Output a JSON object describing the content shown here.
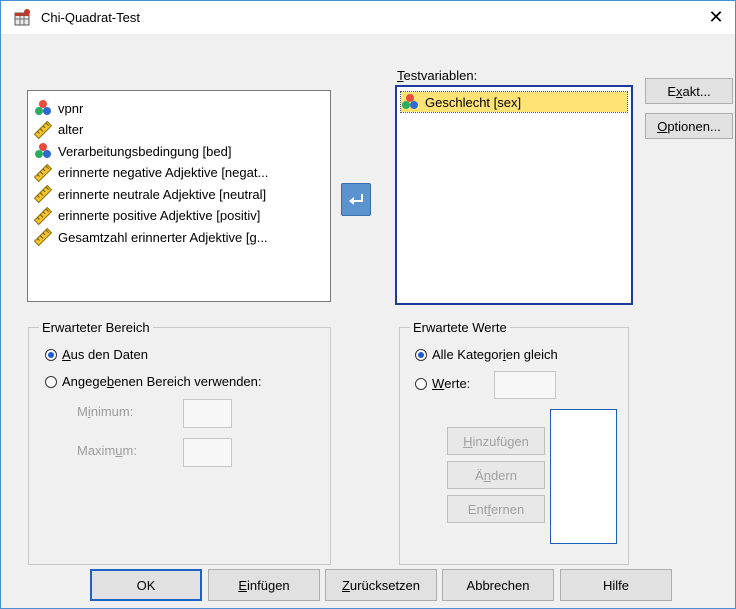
{
  "window": {
    "title": "Chi-Quadrat-Test",
    "close_glyph": "✕"
  },
  "source_list": {
    "items": [
      {
        "label": "vpnr",
        "icon": "nominal-icon"
      },
      {
        "label": "alter",
        "icon": "scale-icon"
      },
      {
        "label": "Verarbeitungsbedingung [bed]",
        "icon": "nominal-icon"
      },
      {
        "label": "erinnerte negative Adjektive [negat...",
        "icon": "scale-icon"
      },
      {
        "label": "erinnerte neutrale Adjektive [neutral]",
        "icon": "scale-icon"
      },
      {
        "label": "erinnerte positive Adjektive [positiv]",
        "icon": "scale-icon"
      },
      {
        "label": "Gesamtzahl erinnerter Adjektive [g...",
        "icon": "scale-icon"
      }
    ]
  },
  "test_vars": {
    "label_prefix": "T",
    "label_rest": "estvariablen:",
    "items": [
      {
        "label": "Geschlecht [sex]",
        "icon": "nominal-icon",
        "selected": true
      }
    ]
  },
  "side_buttons": {
    "exakt_a": "E",
    "exakt_u": "x",
    "exakt_b": "akt...",
    "optionen_u": "O",
    "optionen_b": "ptionen..."
  },
  "range": {
    "legend": "Erwarteter Bereich",
    "opt1_u": "A",
    "opt1_b": "us den Daten",
    "opt2_a": "Angege",
    "opt2_u": "b",
    "opt2_b": "enen Bereich verwenden:",
    "min_a": "M",
    "min_u": "i",
    "min_b": "nimum:",
    "max_a": "Maxim",
    "max_u": "u",
    "max_b": "m:",
    "selected": "data"
  },
  "expected": {
    "legend": "Erwartete Werte",
    "opt1_a": "Alle Kategor",
    "opt1_u": "i",
    "opt1_b": "en gleich",
    "opt2_u": "W",
    "opt2_b": "erte:",
    "add_u": "H",
    "add_b": "inzufügen",
    "change_a": "Ä",
    "change_u": "n",
    "change_b": "dern",
    "remove_a": "Ent",
    "remove_u": "f",
    "remove_b": "ernen",
    "selected": "all"
  },
  "bottom_buttons": {
    "ok": "OK",
    "paste_u": "E",
    "paste_b": "infügen",
    "reset_u": "Z",
    "reset_b": "urücksetzen",
    "cancel": "Abbrechen",
    "help": "Hilfe"
  },
  "colors": {
    "accent": "#1e62c7",
    "selection": "#ffe375",
    "arrow_button": "#5b93cf"
  }
}
